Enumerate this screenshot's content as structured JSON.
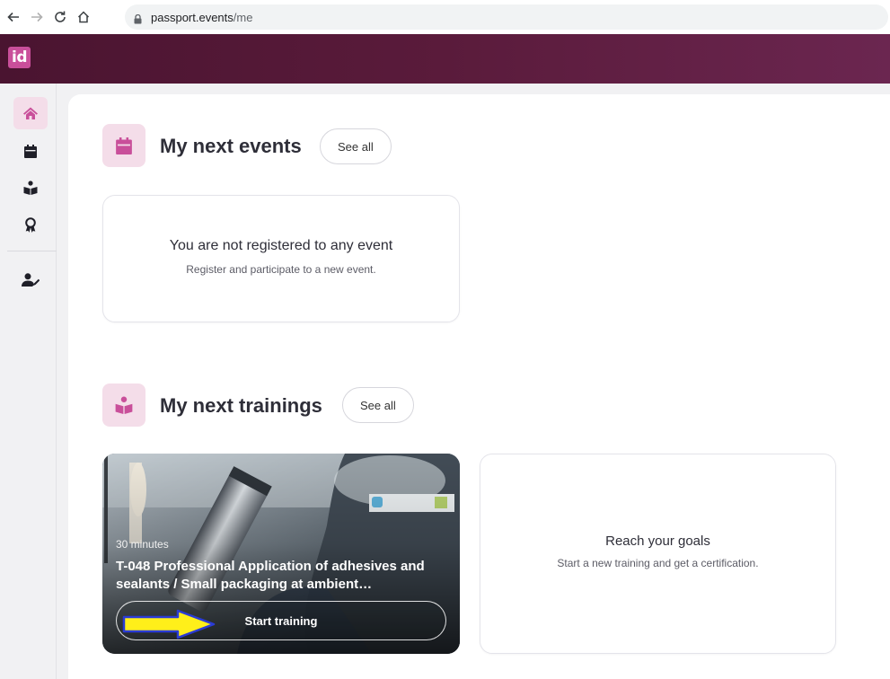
{
  "browser": {
    "url_host": "passport.events",
    "url_path": "/me"
  },
  "app": {
    "logo": "id",
    "colors": {
      "header": "#5a1b3b",
      "accent": "#c94f9a",
      "accent_bg": "#f4dde9"
    }
  },
  "sidebar": {
    "items": [
      {
        "name": "home",
        "icon": "home-icon",
        "active": true
      },
      {
        "name": "events",
        "icon": "calendar-icon",
        "active": false
      },
      {
        "name": "trainings",
        "icon": "reader-icon",
        "active": false
      },
      {
        "name": "certifications",
        "icon": "award-icon",
        "active": false
      },
      {
        "name": "profile",
        "icon": "user-edit-icon",
        "active": false
      }
    ]
  },
  "events_section": {
    "title": "My next events",
    "see_all": "See all",
    "empty_title": "You are not registered to any event",
    "empty_text": "Register and participate to a new event."
  },
  "trainings_section": {
    "title": "My next trainings",
    "see_all": "See all",
    "training": {
      "duration": "30 minutes",
      "title": "T-048 Professional Application of adhesives and sealants / Small packaging at ambient…",
      "button": "Start training"
    },
    "goals_title": "Reach your goals",
    "goals_text": "Start a new training and get a certification."
  }
}
